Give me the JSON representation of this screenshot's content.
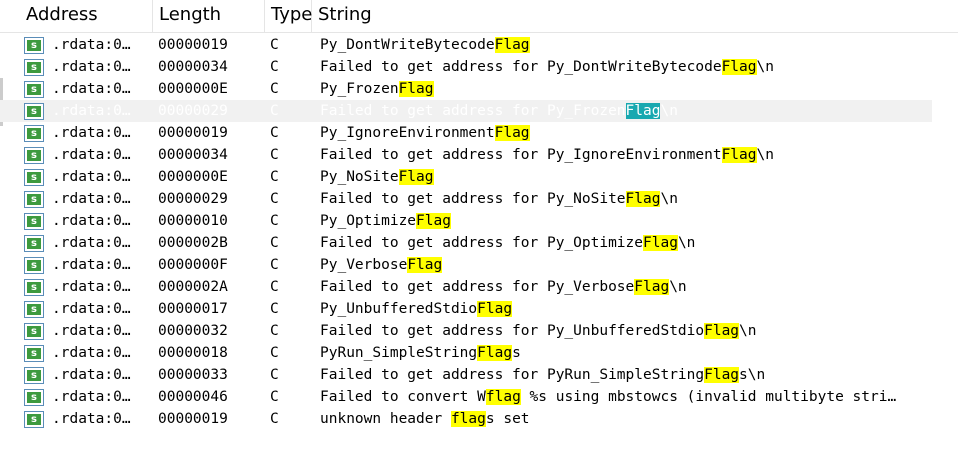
{
  "columns": {
    "address": "Address",
    "length": "Length",
    "type": "Type",
    "string": "String"
  },
  "icon_label": "s",
  "highlight_color": "#ffff00",
  "selected_highlight_color": "#18a8b0",
  "rows": [
    {
      "address": ".rdata:0…",
      "length": "00000019",
      "type": "C",
      "pre": "Py_DontWriteBytecode",
      "match": "Flag",
      "post": ""
    },
    {
      "address": ".rdata:0…",
      "length": "00000034",
      "type": "C",
      "pre": "Failed to get address for Py_DontWriteBytecode",
      "match": "Flag",
      "post": "\\n"
    },
    {
      "address": ".rdata:0…",
      "length": "0000000E",
      "type": "C",
      "pre": "Py_Frozen",
      "match": "Flag",
      "post": ""
    },
    {
      "address": ".rdata:0…",
      "length": "00000029",
      "type": "C",
      "pre": "Failed to get address for Py_Frozen",
      "match": "Flag",
      "post": "\\n",
      "selected": true
    },
    {
      "address": ".rdata:0…",
      "length": "00000019",
      "type": "C",
      "pre": "Py_IgnoreEnvironment",
      "match": "Flag",
      "post": ""
    },
    {
      "address": ".rdata:0…",
      "length": "00000034",
      "type": "C",
      "pre": "Failed to get address for Py_IgnoreEnvironment",
      "match": "Flag",
      "post": "\\n"
    },
    {
      "address": ".rdata:0…",
      "length": "0000000E",
      "type": "C",
      "pre": "Py_NoSite",
      "match": "Flag",
      "post": ""
    },
    {
      "address": ".rdata:0…",
      "length": "00000029",
      "type": "C",
      "pre": "Failed to get address for Py_NoSite",
      "match": "Flag",
      "post": "\\n"
    },
    {
      "address": ".rdata:0…",
      "length": "00000010",
      "type": "C",
      "pre": "Py_Optimize",
      "match": "Flag",
      "post": ""
    },
    {
      "address": ".rdata:0…",
      "length": "0000002B",
      "type": "C",
      "pre": "Failed to get address for Py_Optimize",
      "match": "Flag",
      "post": "\\n"
    },
    {
      "address": ".rdata:0…",
      "length": "0000000F",
      "type": "C",
      "pre": "Py_Verbose",
      "match": "Flag",
      "post": ""
    },
    {
      "address": ".rdata:0…",
      "length": "0000002A",
      "type": "C",
      "pre": "Failed to get address for Py_Verbose",
      "match": "Flag",
      "post": "\\n"
    },
    {
      "address": ".rdata:0…",
      "length": "00000017",
      "type": "C",
      "pre": "Py_UnbufferedStdio",
      "match": "Flag",
      "post": ""
    },
    {
      "address": ".rdata:0…",
      "length": "00000032",
      "type": "C",
      "pre": "Failed to get address for Py_UnbufferedStdio",
      "match": "Flag",
      "post": "\\n"
    },
    {
      "address": ".rdata:0…",
      "length": "00000018",
      "type": "C",
      "pre": "PyRun_SimpleString",
      "match": "Flag",
      "post": "s"
    },
    {
      "address": ".rdata:0…",
      "length": "00000033",
      "type": "C",
      "pre": "Failed to get address for PyRun_SimpleString",
      "match": "Flag",
      "post": "s\\n"
    },
    {
      "address": ".rdata:0…",
      "length": "00000046",
      "type": "C",
      "pre": "Failed to convert W",
      "match": "flag",
      "post": " %s using mbstowcs (invalid multibyte stri…"
    },
    {
      "address": ".rdata:0…",
      "length": "00000019",
      "type": "C",
      "pre": "unknown header ",
      "match": "flag",
      "post": "s set"
    }
  ]
}
